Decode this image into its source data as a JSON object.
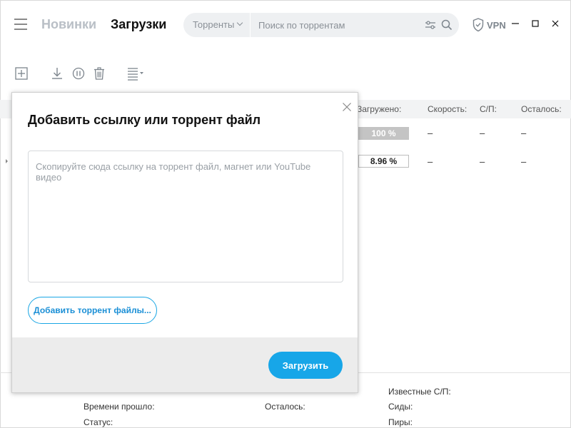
{
  "header": {
    "nav_new": "Новинки",
    "nav_downloads": "Загрузки",
    "search": {
      "category": "Торренты",
      "placeholder": "Поиск по торрентам"
    },
    "vpn_label": "VPN"
  },
  "toolbar": {
    "icons": [
      "add-icon",
      "download-icon",
      "pause-icon",
      "delete-icon",
      "sort-icon"
    ]
  },
  "table": {
    "columns": {
      "downloaded": "Загружено:",
      "speed": "Скорость:",
      "peers": "С/П:",
      "remaining": "Осталось:"
    },
    "rows": [
      {
        "progress": "100 %",
        "speed": "–",
        "peers": "–",
        "remaining": "–"
      },
      {
        "progress": "8.96 %",
        "speed": "–",
        "peers": "–",
        "remaining": "–"
      }
    ]
  },
  "details": {
    "elapsed": "Времени прошло:",
    "status": "Статус:",
    "remaining": "Осталось:",
    "known_peers": "Известные С/П:",
    "seeds": "Сиды:",
    "peers": "Пиры:"
  },
  "modal": {
    "title": "Добавить ссылку или торрент файл",
    "textarea_placeholder": "Скопируйте сюда ссылку на торрент файл, магнет или YouTube видео",
    "add_files_label": "Добавить торрент файлы...",
    "upload_label": "Загрузить"
  },
  "colors": {
    "accent": "#17a6e8",
    "accent_border": "#1aa6e4",
    "footer_bg": "#ececec",
    "search_bg": "#eef0f2"
  }
}
